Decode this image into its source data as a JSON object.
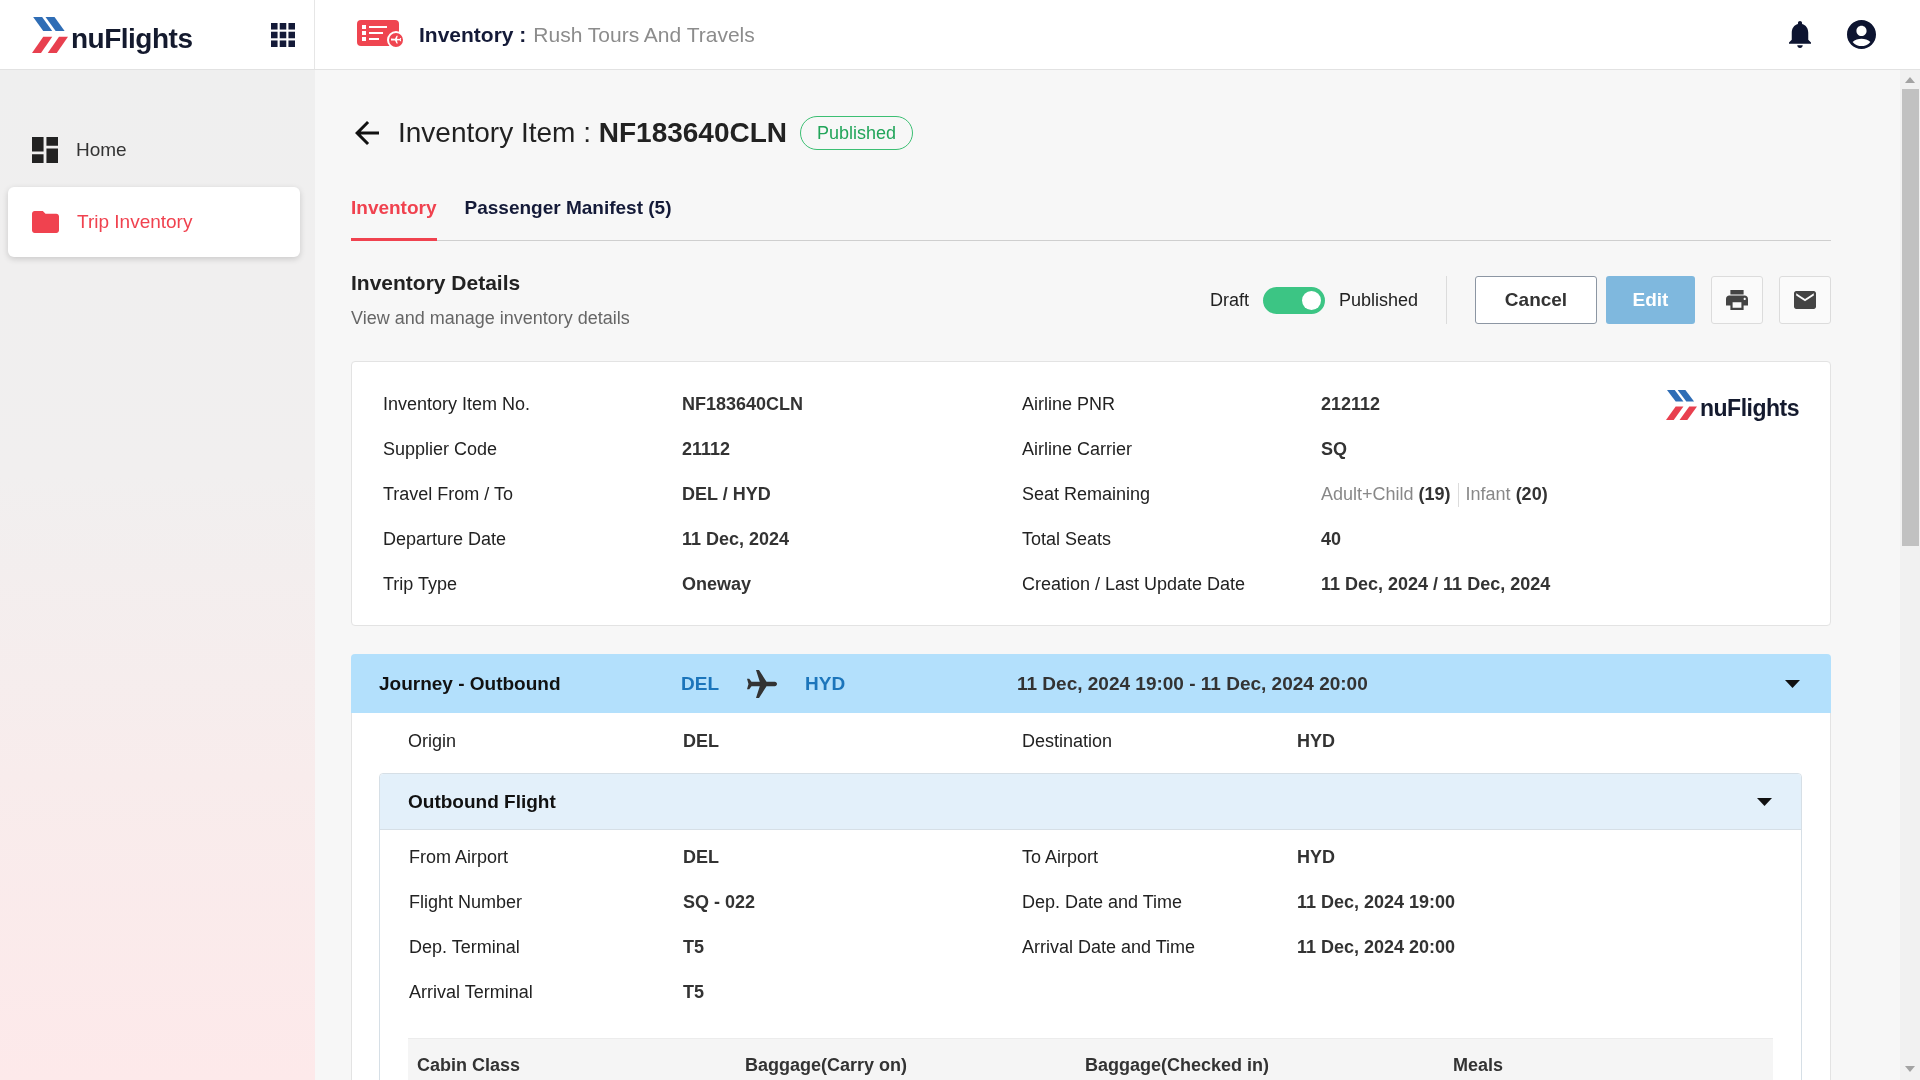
{
  "header": {
    "brand": "nuFlights",
    "title": "Inventory :",
    "agency": "Rush Tours And Travels"
  },
  "sidebar": {
    "items": [
      {
        "label": "Home",
        "selected": false
      },
      {
        "label": "Trip Inventory",
        "selected": true
      }
    ]
  },
  "page": {
    "title": "Inventory Item : **NF183640CLN**",
    "status": "Published"
  },
  "tabs": [
    {
      "label": "Inventory",
      "selected": true
    },
    {
      "label": "Passenger Manifest (5)",
      "selected": false
    }
  ],
  "details": {
    "title": "Inventory Details",
    "subtitle": "View and manage inventory details",
    "status_toggle": {
      "off_label": "Draft",
      "on_label": "Published",
      "on": true
    },
    "buttons": [
      {
        "label": "Cancel",
        "kind": "outline"
      },
      {
        "label": "Edit",
        "kind": "primary"
      }
    ],
    "brand": "nuFlights",
    "fields": [
      {
        "label": "Inventory Item No.",
        "kind": "text",
        "value": "NF183640CLN"
      },
      {
        "label": "Airline PNR",
        "kind": "text",
        "value": "212112"
      },
      {
        "label": "Supplier Code",
        "kind": "text",
        "value": "21112"
      },
      {
        "label": "Airline Carrier",
        "kind": "text",
        "value": "SQ"
      },
      {
        "label": "Travel From / To",
        "kind": "text",
        "value": "DEL / HYD"
      },
      {
        "label": "Seat Remaining",
        "kind": "seats",
        "seats": [
          "Adult+Child **(19)**",
          "Infant **(20)**"
        ]
      },
      {
        "label": "Departure Date",
        "kind": "text",
        "value": "11 Dec, 2024"
      },
      {
        "label": "Total Seats",
        "kind": "text",
        "value": "40"
      },
      {
        "label": "Trip Type",
        "kind": "text",
        "value": "Oneway"
      },
      {
        "label": "Creation / Last Update Date",
        "kind": "text",
        "value": "11 Dec, 2024 / 11 Dec, 2024"
      }
    ]
  },
  "journey": {
    "title": "Journey - Outbound",
    "from": "DEL",
    "to": "HYD",
    "schedule": "11 Dec, 2024 19:00 - 11 Dec, 2024 20:00",
    "expanded": true,
    "fields": [
      {
        "label": "Origin",
        "value": "DEL"
      },
      {
        "label": "Destination",
        "value": "HYD"
      }
    ],
    "flight": {
      "title": "Outbound Flight",
      "expanded": true,
      "fields": [
        {
          "label": "From Airport",
          "value": "DEL"
        },
        {
          "label": "To Airport",
          "value": "HYD"
        },
        {
          "label": "Flight Number",
          "value": "SQ - 022"
        },
        {
          "label": "Dep. Date and Time",
          "value": "11 Dec, 2024 19:00"
        },
        {
          "label": "Dep. Terminal",
          "value": "T5"
        },
        {
          "label": "Arrival Date and Time",
          "value": "11 Dec, 2024 20:00"
        },
        {
          "label": "Arrival Terminal",
          "value": "T5"
        }
      ],
      "table": {
        "columns": [
          "Cabin Class",
          "Baggage(Carry on)",
          "Baggage(Checked in)",
          "Meals"
        ]
      }
    }
  }
}
